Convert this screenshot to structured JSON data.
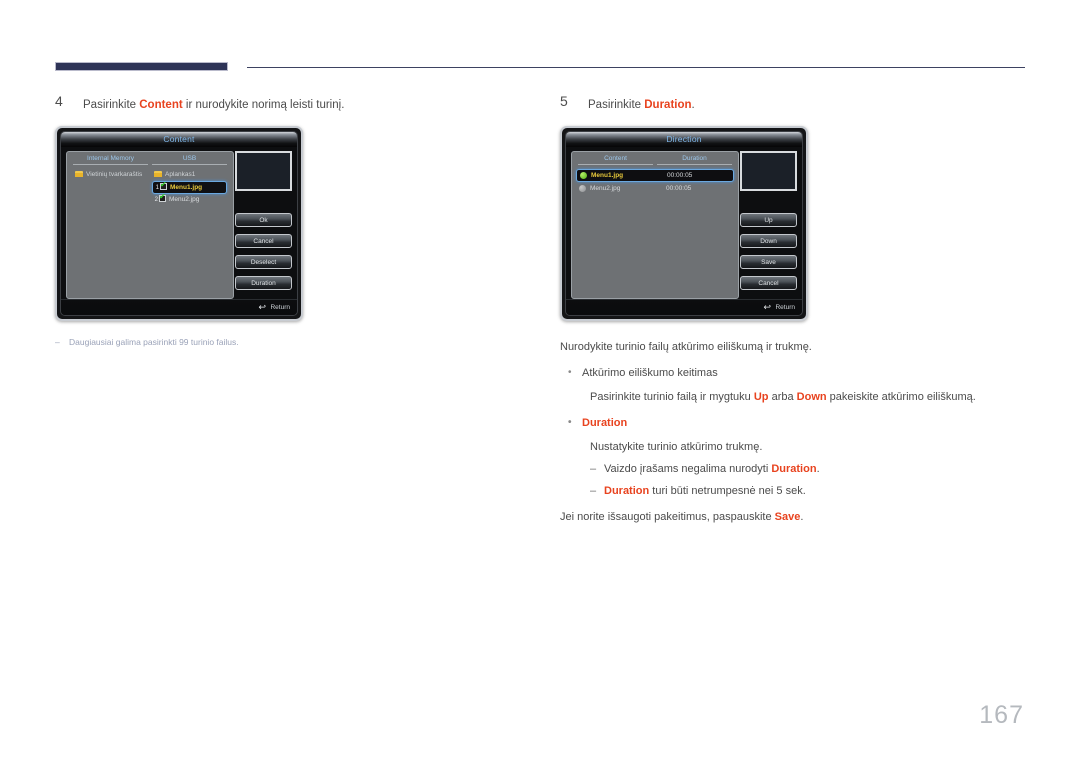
{
  "page": {
    "number": "167"
  },
  "steps": [
    {
      "num": "4",
      "text_before": "Pasirinkite ",
      "highlight": "Content",
      "text_after": " ir nurodykite norimą leisti turinį."
    },
    {
      "num": "5",
      "text_before": "Pasirinkite ",
      "highlight": "Duration",
      "text_after": "."
    }
  ],
  "content_dialog": {
    "title": "Content",
    "columns": {
      "left": "Internal Memory",
      "right": "USB"
    },
    "internal_items": [
      {
        "label": "Vietinių tvarkaraštis",
        "icon": "folder-icon"
      }
    ],
    "usb_items": [
      {
        "index": "",
        "label": "Aplankas1",
        "icon": "folder-icon",
        "type": "folder",
        "selected": false
      },
      {
        "index": "1",
        "label": "Menu1.jpg",
        "icon": "checkbox-checked-icon",
        "type": "file",
        "selected": true
      },
      {
        "index": "2",
        "label": "Menu2.jpg",
        "icon": "checkbox-checked-icon",
        "type": "file",
        "selected": false
      }
    ],
    "buttons": [
      "Ok",
      "Cancel",
      "Deselect",
      "Duration"
    ],
    "return_label": "Return"
  },
  "direction_dialog": {
    "title": "Direction",
    "columns": {
      "left": "Content",
      "right": "Duration"
    },
    "rows": [
      {
        "name": "Menu1.jpg",
        "duration": "00:00:05",
        "selected": true
      },
      {
        "name": "Menu2.jpg",
        "duration": "00:00:05",
        "selected": false
      }
    ],
    "buttons": [
      "Up",
      "Down",
      "Save",
      "Cancel"
    ],
    "return_label": "Return"
  },
  "left_note": "Daugiausiai galima pasirinkti 99 turinio failus.",
  "right_notes": {
    "intro": "Nurodykite turinio failų atkūrimo eiliškumą ir trukmę.",
    "bullet1": "Atkūrimo eiliškumo keitimas",
    "bullet1_sub_a": "Pasirinkite turinio failą ir mygtuku ",
    "bullet1_sub_hl1": "Up",
    "bullet1_sub_b": " arba ",
    "bullet1_sub_hl2": "Down",
    "bullet1_sub_c": " pakeiskite atkūrimo eiliškumą.",
    "bullet2": "Duration",
    "bullet2_sub": "Nustatykite turinio atkūrimo trukmę.",
    "dash1_a": "Vaizdo įrašams negalima nurodyti ",
    "dash1_hl": "Duration",
    "dash1_b": ".",
    "dash2_hl": "Duration",
    "dash2_b": " turi būti netrumpesnė nei 5 sek.",
    "closing_a": "Jei norite išsaugoti pakeitimus, paspauskite ",
    "closing_hl": "Save",
    "closing_b": "."
  }
}
